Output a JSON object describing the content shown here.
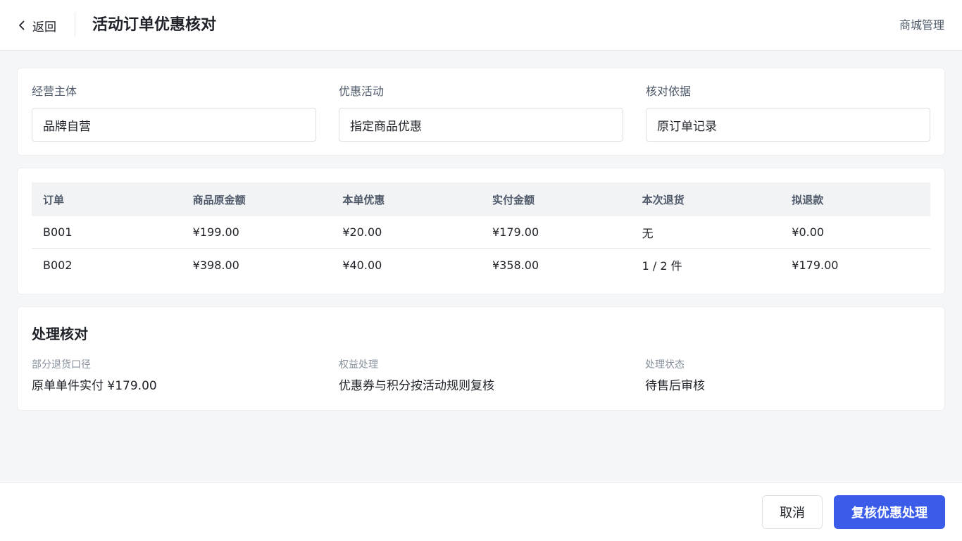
{
  "header": {
    "back_label": "返回",
    "title": "活动订单优惠核对",
    "right_link": "商城管理"
  },
  "filters": [
    {
      "label": "经营主体",
      "value": "品牌自营"
    },
    {
      "label": "优惠活动",
      "value": "指定商品优惠"
    },
    {
      "label": "核对依据",
      "value": "原订单记录"
    }
  ],
  "table": {
    "columns": [
      "订单",
      "商品原金额",
      "本单优惠",
      "实付金额",
      "本次退货",
      "拟退款"
    ],
    "rows": [
      [
        "B001",
        "¥199.00",
        "¥20.00",
        "¥179.00",
        "无",
        "¥0.00"
      ],
      [
        "B002",
        "¥398.00",
        "¥40.00",
        "¥358.00",
        "1 / 2 件",
        "¥179.00"
      ]
    ]
  },
  "check": {
    "title": "处理核对",
    "items": [
      {
        "label": "部分退货口径",
        "value": "原单单件实付 ¥179.00"
      },
      {
        "label": "权益处理",
        "value": "优惠券与积分按活动规则复核"
      },
      {
        "label": "处理状态",
        "value": "待售后审核"
      }
    ]
  },
  "footer": {
    "cancel_label": "取消",
    "confirm_label": "复核优惠处理"
  },
  "colors": {
    "primary": "#3a5ce9",
    "background": "#f5f6f8"
  }
}
